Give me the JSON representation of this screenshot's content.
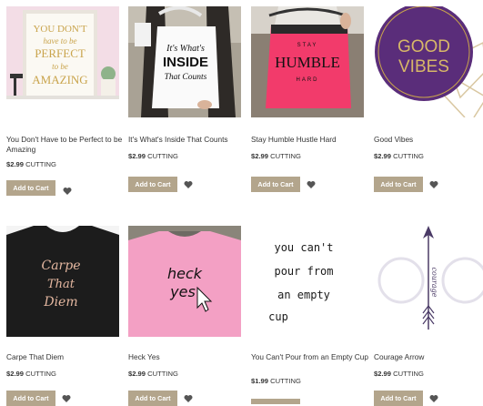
{
  "colors": {
    "button_bg": "#b3a58c",
    "button_text": "#ffffff",
    "heart": "#555555"
  },
  "products": [
    {
      "title": "You Don't Have to be Perfect to be Amazing",
      "price": "$2.99",
      "type": "CUTTING",
      "button": "Add to Cart",
      "image_text": [
        "YOU DON'T",
        "have to be",
        "PERFECT",
        "to be",
        "AMAZING"
      ]
    },
    {
      "title": "It's What's Inside That Counts",
      "price": "$2.99",
      "type": "CUTTING",
      "button": "Add to Cart",
      "image_text": [
        "It's What's",
        "INSIDE",
        "That Counts"
      ]
    },
    {
      "title": "Stay Humble Hustle Hard",
      "price": "$2.99",
      "type": "CUTTING",
      "button": "Add to Cart",
      "image_text": [
        "STAY",
        "HUMBLE",
        "HARD"
      ]
    },
    {
      "title": "Good Vibes",
      "price": "$2.99",
      "type": "CUTTING",
      "button": "Add to Cart",
      "image_text": [
        "GOOD",
        "VIBES"
      ]
    },
    {
      "title": "Carpe That Diem",
      "price": "$2.99",
      "type": "CUTTING",
      "button": "Add to Cart",
      "image_text": [
        "Carpe",
        "That",
        "Diem"
      ]
    },
    {
      "title": "Heck Yes",
      "price": "$2.99",
      "type": "CUTTING",
      "button": "Add to Cart",
      "image_text": [
        "heck",
        "yes"
      ]
    },
    {
      "title": "You Can't Pour from an Empty Cup",
      "price": "$1.99",
      "type": "CUTTING",
      "button": "",
      "image_text": [
        "you can't",
        "pour from",
        "an empty",
        "cup"
      ]
    },
    {
      "title": "Courage Arrow",
      "price": "$2.99",
      "type": "CUTTING",
      "button": "Add to Cart",
      "image_text": [
        "courage"
      ]
    }
  ]
}
